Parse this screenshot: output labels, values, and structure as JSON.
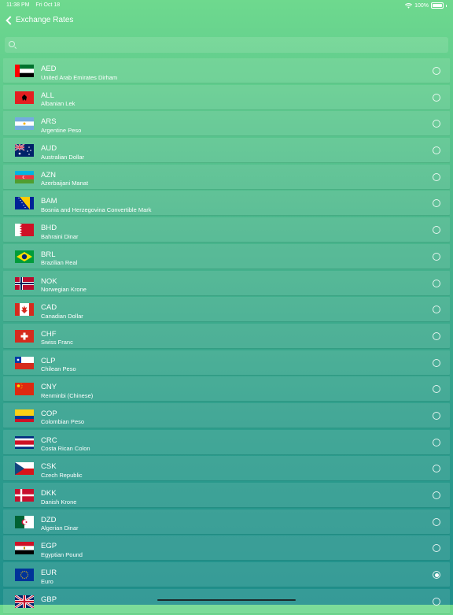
{
  "status_bar": {
    "time": "11:38 PM",
    "date": "Fri Oct 18",
    "battery": "100%"
  },
  "nav": {
    "back_label": "Exchange Rates"
  },
  "search": {
    "placeholder": ""
  },
  "currencies": [
    {
      "code": "AED",
      "name": "United Arab Emirates Dirham",
      "selected": false,
      "flag_icon": "uae-flag-icon"
    },
    {
      "code": "ALL",
      "name": "Albanian Lek",
      "selected": false,
      "flag_icon": "albania-flag-icon"
    },
    {
      "code": "ARS",
      "name": "Argentine Peso",
      "selected": false,
      "flag_icon": "argentina-flag-icon"
    },
    {
      "code": "AUD",
      "name": "Australian Dollar",
      "selected": false,
      "flag_icon": "australia-flag-icon"
    },
    {
      "code": "AZN",
      "name": "Azerbaijani Manat",
      "selected": false,
      "flag_icon": "azerbaijan-flag-icon"
    },
    {
      "code": "BAM",
      "name": "Bosnia and Herzegovina Convertible Mark",
      "selected": false,
      "flag_icon": "bosnia-flag-icon"
    },
    {
      "code": "BHD",
      "name": "Bahraini Dinar",
      "selected": false,
      "flag_icon": "bahrain-flag-icon"
    },
    {
      "code": "BRL",
      "name": "Brazilian Real",
      "selected": false,
      "flag_icon": "brazil-flag-icon"
    },
    {
      "code": "NOK",
      "name": "Norwegian Krone",
      "selected": false,
      "flag_icon": "norway-flag-icon"
    },
    {
      "code": "CAD",
      "name": "Canadian Dollar",
      "selected": false,
      "flag_icon": "canada-flag-icon"
    },
    {
      "code": "CHF",
      "name": "Swiss Franc",
      "selected": false,
      "flag_icon": "switzerland-flag-icon"
    },
    {
      "code": "CLP",
      "name": "Chilean Peso",
      "selected": false,
      "flag_icon": "chile-flag-icon"
    },
    {
      "code": "CNY",
      "name": "Renminbi (Chinese)",
      "selected": false,
      "flag_icon": "china-flag-icon"
    },
    {
      "code": "COP",
      "name": "Colombian Peso",
      "selected": false,
      "flag_icon": "colombia-flag-icon"
    },
    {
      "code": "CRC",
      "name": "Costa Rican Colon",
      "selected": false,
      "flag_icon": "costa-rica-flag-icon"
    },
    {
      "code": "CSK",
      "name": "Czech Republic",
      "selected": false,
      "flag_icon": "czech-flag-icon"
    },
    {
      "code": "DKK",
      "name": "Danish Krone",
      "selected": false,
      "flag_icon": "denmark-flag-icon"
    },
    {
      "code": "DZD",
      "name": "Algerian Dinar",
      "selected": false,
      "flag_icon": "algeria-flag-icon"
    },
    {
      "code": "EGP",
      "name": "Egyptian Pound",
      "selected": false,
      "flag_icon": "egypt-flag-icon"
    },
    {
      "code": "EUR",
      "name": "Euro",
      "selected": true,
      "flag_icon": "eu-flag-icon"
    },
    {
      "code": "GBP",
      "name": "",
      "selected": false,
      "flag_icon": "uk-flag-icon"
    }
  ]
}
